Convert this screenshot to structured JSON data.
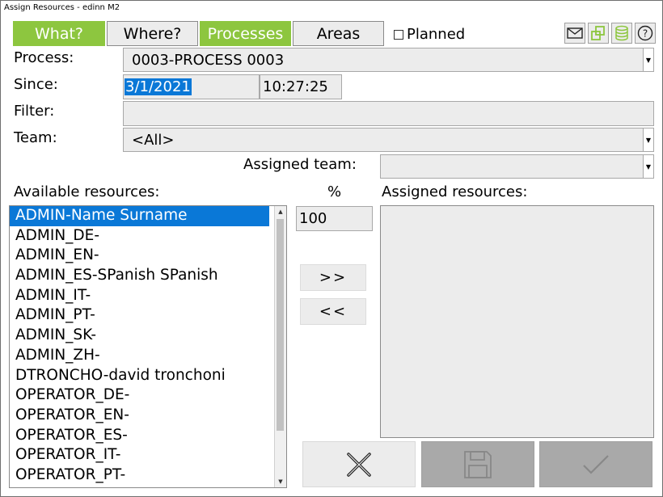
{
  "window": {
    "title": "Assign Resources - edinn M2"
  },
  "tabs": [
    {
      "label": "What?",
      "active": true
    },
    {
      "label": "Where?",
      "active": false
    },
    {
      "label": "Processes",
      "active": true
    },
    {
      "label": "Areas",
      "active": false
    }
  ],
  "planned": {
    "label": "Planned",
    "checked": false
  },
  "toolbar_icons": [
    "mail-icon",
    "copy-icon",
    "database-icon",
    "help-icon"
  ],
  "form": {
    "process_label": "Process:",
    "process_value": "0003-PROCESS 0003",
    "since_label": "Since:",
    "since_date": "3/1/2021",
    "since_time": "10:27:25",
    "filter_label": "Filter:",
    "filter_value": "",
    "team_label": "Team:",
    "team_value": "<All>",
    "assigned_team_label": "Assigned team:",
    "assigned_team_value": ""
  },
  "available": {
    "label": "Available resources:",
    "items": [
      "ADMIN-Name Surname",
      "ADMIN_DE-",
      "ADMIN_EN-",
      "ADMIN_ES-SPanish SPanish",
      "ADMIN_IT-",
      "ADMIN_PT-",
      "ADMIN_SK-",
      "ADMIN_ZH-",
      "DTRONCHO-david tronchoni",
      "OPERATOR_DE-",
      "OPERATOR_EN-",
      "OPERATOR_ES-",
      "OPERATOR_IT-",
      "OPERATOR_PT-"
    ],
    "selected_index": 0
  },
  "percent": {
    "label": "%",
    "value": "100"
  },
  "move": {
    "add_label": ">>",
    "remove_label": "<<"
  },
  "assigned": {
    "label": "Assigned resources:",
    "items": []
  },
  "actions": [
    "cancel-icon",
    "save-icon",
    "confirm-icon"
  ],
  "colors": {
    "accent": "#8dc63f",
    "selection": "#0a78d7",
    "field_bg": "#ececec",
    "disabled_bg": "#a9a9a9"
  }
}
